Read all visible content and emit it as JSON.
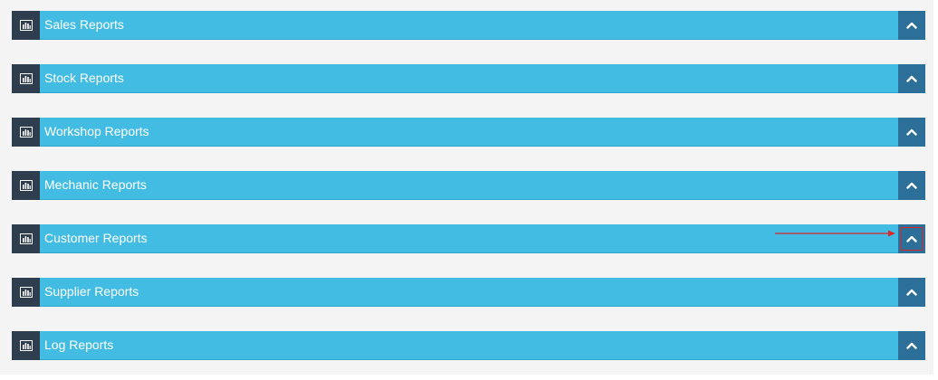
{
  "panels": [
    {
      "id": "sales",
      "title": "Sales Reports",
      "icon": "bar-chart-icon",
      "toggle_icon": "chevron-up-icon",
      "highlighted": false
    },
    {
      "id": "stock",
      "title": "Stock Reports",
      "icon": "bar-chart-icon",
      "toggle_icon": "chevron-up-icon",
      "highlighted": false
    },
    {
      "id": "workshop",
      "title": "Workshop Reports",
      "icon": "bar-chart-icon",
      "toggle_icon": "chevron-up-icon",
      "highlighted": false
    },
    {
      "id": "mechanic",
      "title": "Mechanic Reports",
      "icon": "bar-chart-icon",
      "toggle_icon": "chevron-up-icon",
      "highlighted": false
    },
    {
      "id": "customer",
      "title": "Customer Reports",
      "icon": "bar-chart-icon",
      "toggle_icon": "chevron-up-icon",
      "highlighted": true
    },
    {
      "id": "supplier",
      "title": "Supplier Reports",
      "icon": "bar-chart-icon",
      "toggle_icon": "chevron-up-icon",
      "highlighted": false
    },
    {
      "id": "log",
      "title": "Log Reports",
      "icon": "bar-chart-icon",
      "toggle_icon": "chevron-up-icon",
      "highlighted": false
    }
  ],
  "annotation": {
    "type": "arrow",
    "points_to": "customer-reports-collapse-button",
    "color": "#d9262b"
  },
  "colors": {
    "panel_header": "#42bce2",
    "icon_box": "#2f3e4f",
    "toggle_button": "#2c6f98",
    "background": "#f4f4f4",
    "title_text": "#ffffff"
  }
}
